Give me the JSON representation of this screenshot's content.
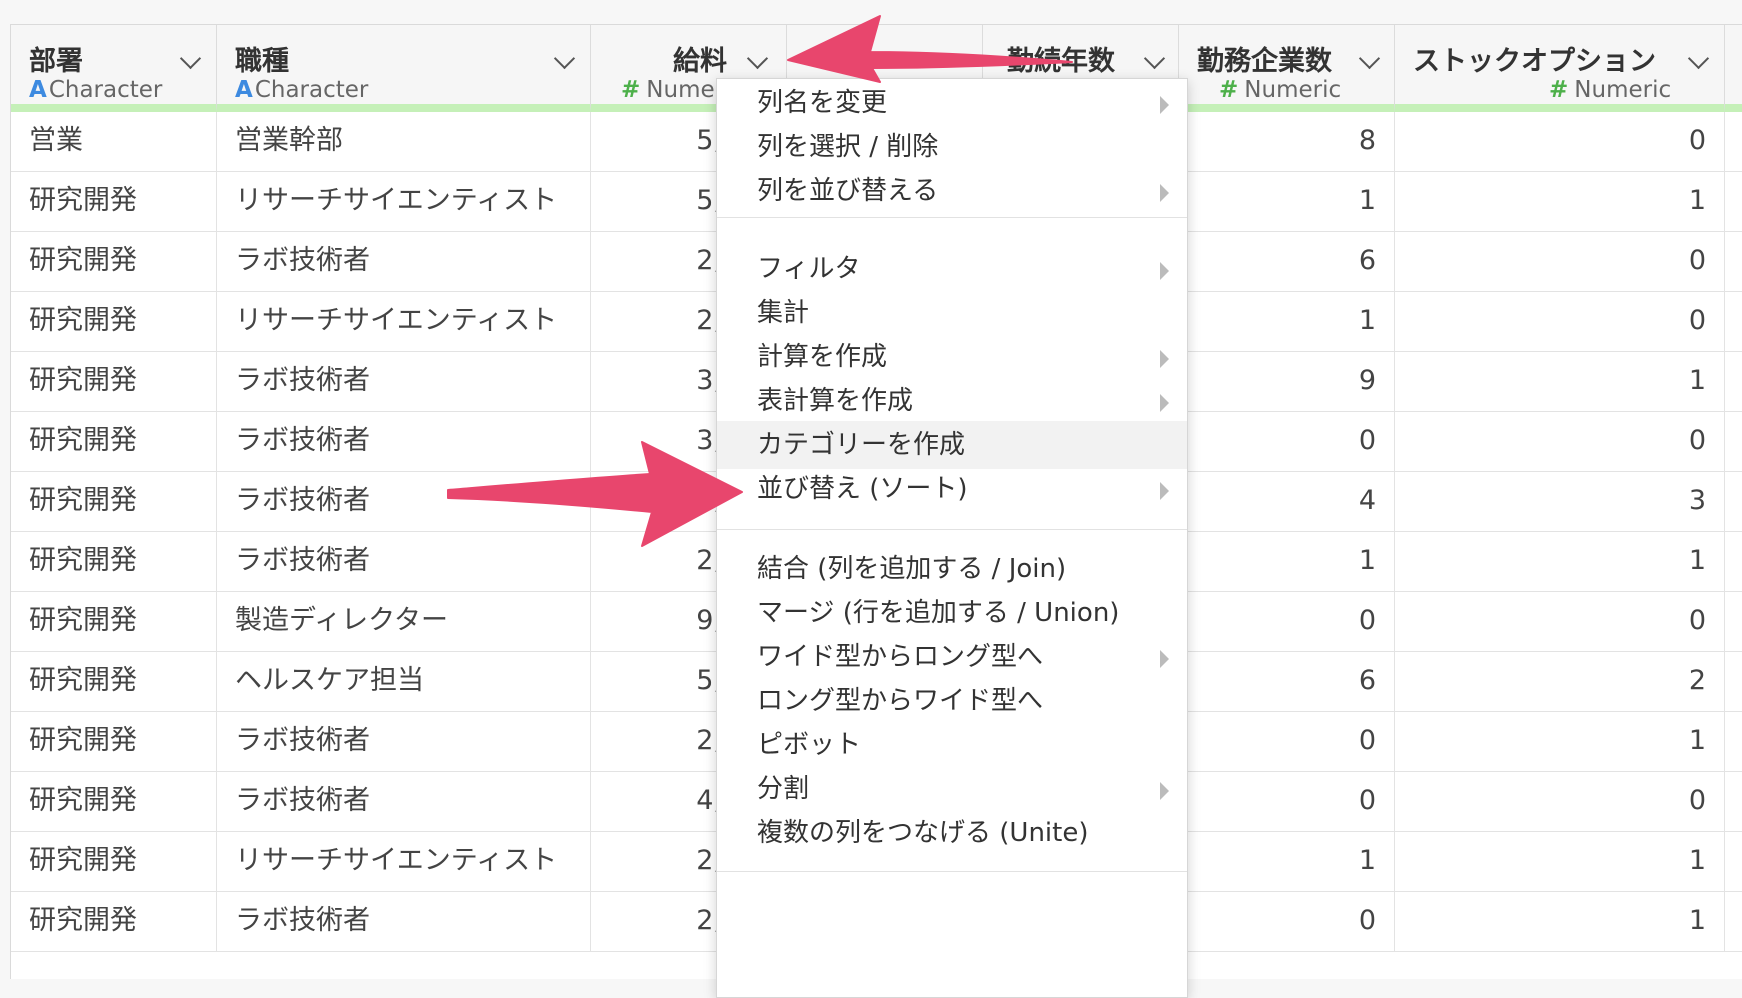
{
  "columns": [
    {
      "name": "部署",
      "type": "Character",
      "type_icon": "A"
    },
    {
      "name": "職種",
      "type": "Character",
      "type_icon": "A"
    },
    {
      "name": "給料",
      "type": "Numeric",
      "type_icon": "#"
    },
    {
      "name": "勤続年数",
      "type": "Numeric",
      "type_icon": "#"
    },
    {
      "name": "勤務企業数",
      "type": "Numeric",
      "type_icon": "#"
    },
    {
      "name": "ストックオプション",
      "type": "Numeric",
      "type_icon": "#"
    }
  ],
  "partial_type_label": "# Numeri",
  "rows": [
    {
      "dept": "営業",
      "job": "営業幹部",
      "salary": "5,",
      "companies": "8",
      "stock": "0"
    },
    {
      "dept": "研究開発",
      "job": "リサーチサイエンティスト",
      "salary": "5,",
      "companies": "1",
      "stock": "1"
    },
    {
      "dept": "研究開発",
      "job": "ラボ技術者",
      "salary": "2,",
      "companies": "6",
      "stock": "0"
    },
    {
      "dept": "研究開発",
      "job": "リサーチサイエンティスト",
      "salary": "2,",
      "companies": "1",
      "stock": "0"
    },
    {
      "dept": "研究開発",
      "job": "ラボ技術者",
      "salary": "3,",
      "companies": "9",
      "stock": "1"
    },
    {
      "dept": "研究開発",
      "job": "ラボ技術者",
      "salary": "3,",
      "companies": "0",
      "stock": "0"
    },
    {
      "dept": "研究開発",
      "job": "ラボ技術者",
      "salary": "2,",
      "companies": "4",
      "stock": "3"
    },
    {
      "dept": "研究開発",
      "job": "ラボ技術者",
      "salary": "2,",
      "companies": "1",
      "stock": "1"
    },
    {
      "dept": "研究開発",
      "job": "製造ディレクター",
      "salary": "9,",
      "companies": "0",
      "stock": "0"
    },
    {
      "dept": "研究開発",
      "job": "ヘルスケア担当",
      "salary": "5,",
      "companies": "6",
      "stock": "2"
    },
    {
      "dept": "研究開発",
      "job": "ラボ技術者",
      "salary": "2,",
      "companies": "0",
      "stock": "1"
    },
    {
      "dept": "研究開発",
      "job": "ラボ技術者",
      "salary": "4,",
      "companies": "0",
      "stock": "0"
    },
    {
      "dept": "研究開発",
      "job": "リサーチサイエンティスト",
      "salary": "2,",
      "companies": "1",
      "stock": "1"
    },
    {
      "dept": "研究開発",
      "job": "ラボ技術者",
      "salary": "2,",
      "companies": "0",
      "stock": "1"
    }
  ],
  "menu": [
    {
      "label": "列名を変更",
      "submenu": true
    },
    {
      "label": "列を選択 / 削除",
      "submenu": false
    },
    {
      "label": "列を並び替える",
      "submenu": true
    },
    {
      "label": "フィルタ",
      "submenu": true
    },
    {
      "label": "集計",
      "submenu": false
    },
    {
      "label": "計算を作成",
      "submenu": true
    },
    {
      "label": "表計算を作成",
      "submenu": true
    },
    {
      "label": "カテゴリーを作成",
      "submenu": false,
      "highlighted": true
    },
    {
      "label": "並び替え (ソート)",
      "submenu": true
    },
    {
      "label": "結合 (列を追加する / Join)",
      "submenu": false
    },
    {
      "label": "マージ (行を追加する / Union)",
      "submenu": false
    },
    {
      "label": "ワイド型からロング型へ",
      "submenu": true
    },
    {
      "label": "ロング型からワイド型へ",
      "submenu": false
    },
    {
      "label": "ピボット",
      "submenu": false
    },
    {
      "label": "分割",
      "submenu": true
    },
    {
      "label": "複数の列をつなげる (Unite)",
      "submenu": false
    }
  ],
  "colors": {
    "arrow": "#e8466d",
    "header_accent": "#c5f0b8",
    "character_icon": "#3d8ae0",
    "numeric_icon": "#4db04a"
  }
}
